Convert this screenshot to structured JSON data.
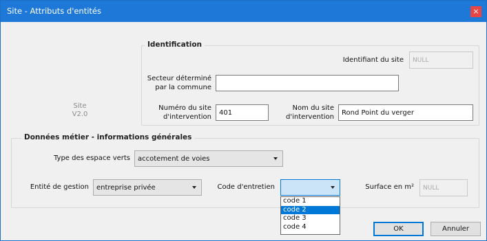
{
  "window": {
    "title": "Site - Attributs d'entités",
    "close_glyph": "×"
  },
  "side_info": {
    "line1": "Site",
    "line2": "V2.0"
  },
  "identification": {
    "title": "Identification",
    "identifiant": {
      "label": "Identifiant du site",
      "value": "NULL"
    },
    "secteur": {
      "label_line1": "Secteur déterminé",
      "label_line2": "par la commune",
      "value": ""
    },
    "numero": {
      "label_line1": "Numéro du site",
      "label_line2": "d'intervention",
      "value": "401"
    },
    "nom": {
      "label_line1": "Nom du site",
      "label_line2": "d'intervention",
      "value": "Rond Point du verger"
    }
  },
  "donnees": {
    "title": "Données métier - informations générales",
    "type_espace": {
      "label": "Type des espace verts",
      "value": "accotement de voies"
    },
    "entite_gestion": {
      "label": "Entité de gestion",
      "value": "entreprise privée"
    },
    "code_entretien": {
      "label": "Code d'entretien",
      "value": "",
      "options": [
        "code 1",
        "code 2",
        "code 3",
        "code 4"
      ],
      "highlighted": "code 2"
    },
    "surface": {
      "label": "Surface en m²",
      "value": "NULL"
    }
  },
  "buttons": {
    "ok": "OK",
    "cancel": "Annuler"
  },
  "colors": {
    "titlebar": "#1e78d7",
    "close": "#e64646",
    "selection": "#0078d7"
  },
  "icons": {
    "close": "close-icon",
    "combo_arrow": "chevron-down-icon"
  }
}
